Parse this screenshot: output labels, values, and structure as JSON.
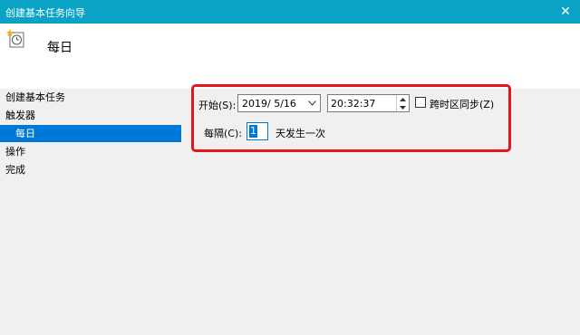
{
  "window": {
    "title": "创建基本任务向导",
    "close_glyph": "✕"
  },
  "header": {
    "icon": "task-scheduler-icon",
    "heading": "每日"
  },
  "sidebar": {
    "items": [
      {
        "label": "创建基本任务"
      },
      {
        "label": "触发器"
      },
      {
        "label": "每日",
        "selected": true
      },
      {
        "label": "操作"
      },
      {
        "label": "完成"
      }
    ]
  },
  "trigger": {
    "start_label": "开始(S):",
    "start_date": "2019/  5/16",
    "start_time": "20:32:37",
    "sync_timezone_label": "跨时区同步(Z)",
    "sync_timezone_checked": false,
    "recur_label": "每隔(C):",
    "recur_value": "1",
    "recur_suffix": "天发生一次"
  },
  "colors": {
    "titlebar": "#0aa3c6",
    "selection": "#0078d7",
    "highlight_border": "#e3151d"
  }
}
